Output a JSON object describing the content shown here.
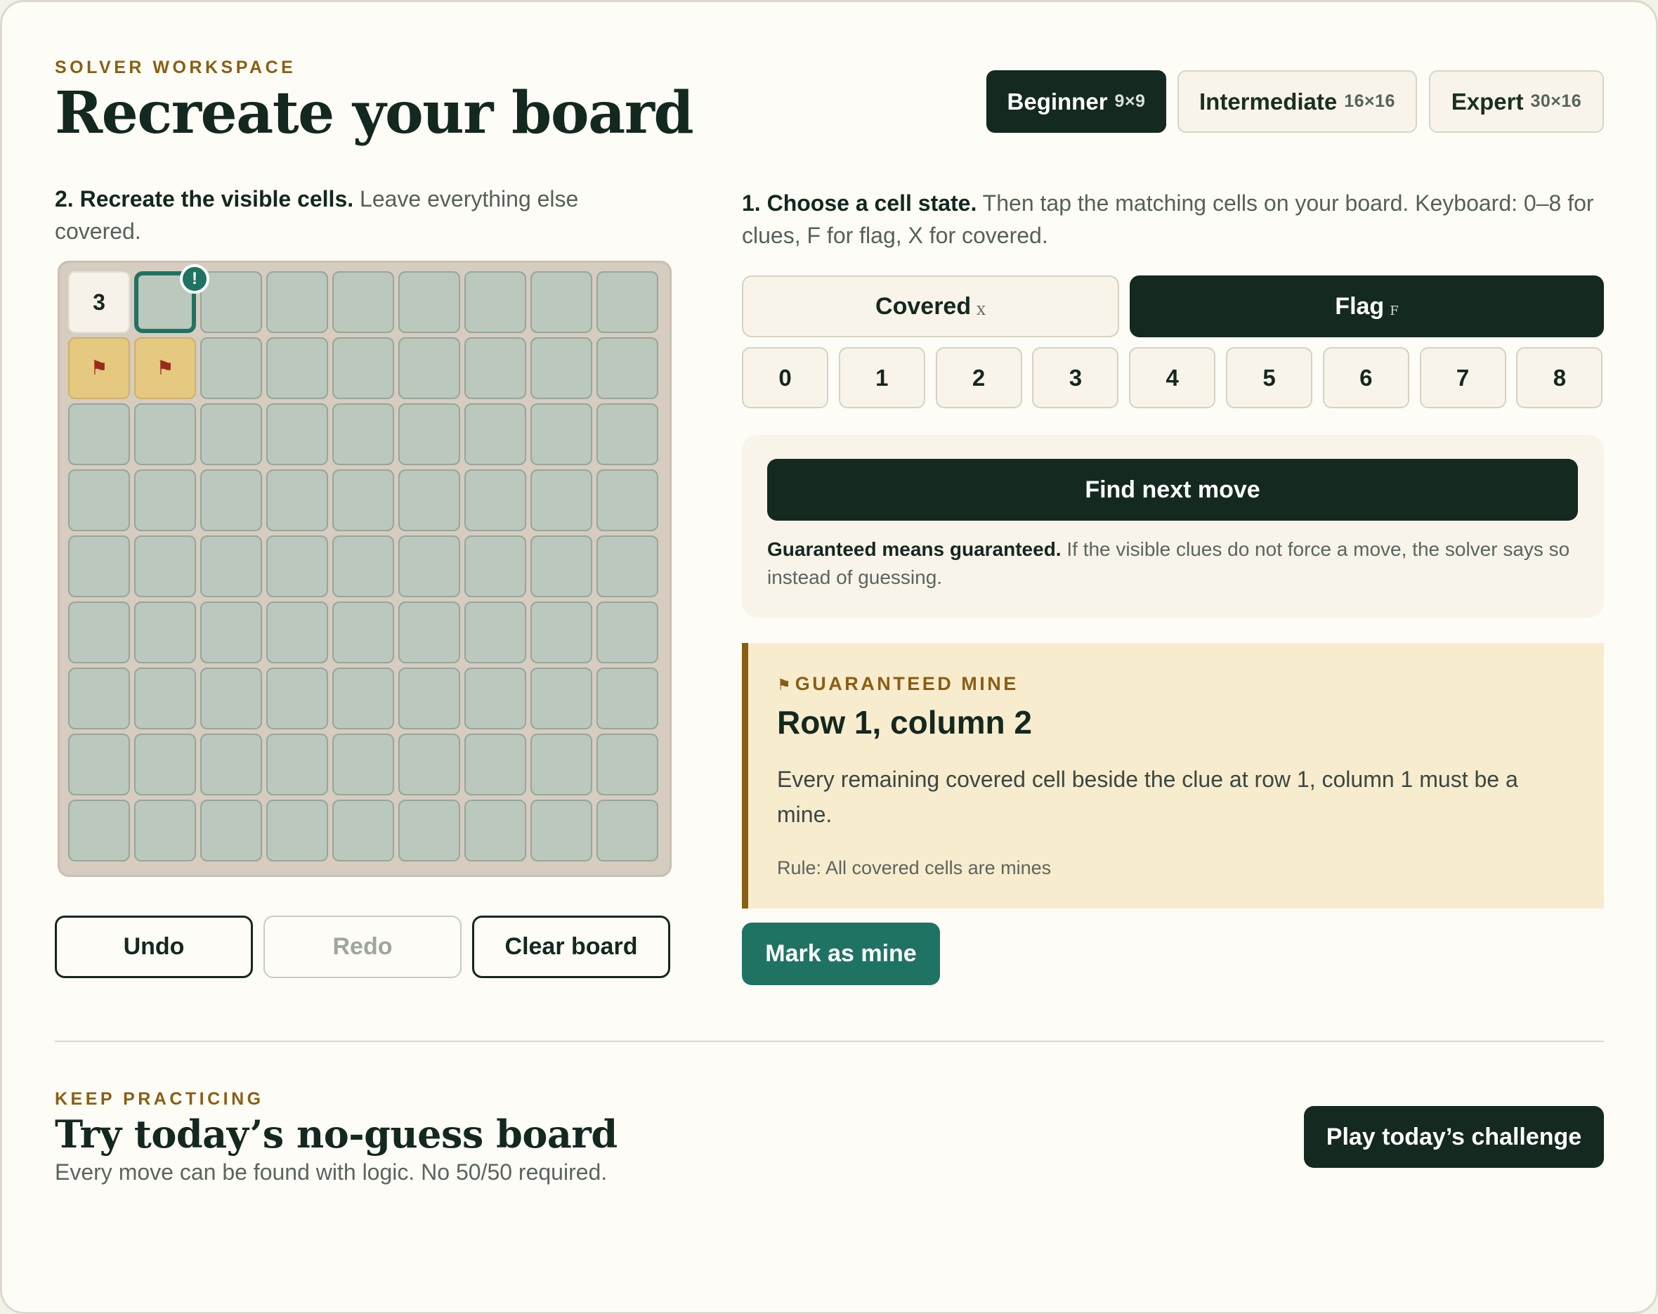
{
  "header": {
    "eyebrow": "SOLVER WORKSPACE",
    "title": "Recreate your board"
  },
  "difficulty": [
    {
      "label": "Beginner",
      "size": "9×9",
      "active": true
    },
    {
      "label": "Intermediate",
      "size": "16×16",
      "active": false
    },
    {
      "label": "Expert",
      "size": "30×16",
      "active": false
    }
  ],
  "left_instruction": {
    "bold": "2. Recreate the visible cells.",
    "text": " Leave everything else covered."
  },
  "right_instruction": {
    "bold": "1. Choose a cell state.",
    "text": " Then tap the matching cells on your board. Keyboard: 0–8 for clues, F for flag, X for covered."
  },
  "board": {
    "rows": 9,
    "cols": 9,
    "cells": [
      [
        "3",
        "target",
        "covered",
        "covered",
        "covered",
        "covered",
        "covered",
        "covered",
        "covered"
      ],
      [
        "flag",
        "flag",
        "covered",
        "covered",
        "covered",
        "covered",
        "covered",
        "covered",
        "covered"
      ],
      [
        "covered",
        "covered",
        "covered",
        "covered",
        "covered",
        "covered",
        "covered",
        "covered",
        "covered"
      ],
      [
        "covered",
        "covered",
        "covered",
        "covered",
        "covered",
        "covered",
        "covered",
        "covered",
        "covered"
      ],
      [
        "covered",
        "covered",
        "covered",
        "covered",
        "covered",
        "covered",
        "covered",
        "covered",
        "covered"
      ],
      [
        "covered",
        "covered",
        "covered",
        "covered",
        "covered",
        "covered",
        "covered",
        "covered",
        "covered"
      ],
      [
        "covered",
        "covered",
        "covered",
        "covered",
        "covered",
        "covered",
        "covered",
        "covered",
        "covered"
      ],
      [
        "covered",
        "covered",
        "covered",
        "covered",
        "covered",
        "covered",
        "covered",
        "covered",
        "covered"
      ],
      [
        "covered",
        "covered",
        "covered",
        "covered",
        "covered",
        "covered",
        "covered",
        "covered",
        "covered"
      ]
    ],
    "badge": "!",
    "flag_glyph": "⚑"
  },
  "actions": {
    "undo": "Undo",
    "redo": "Redo",
    "clear": "Clear board"
  },
  "states": {
    "covered_label": "Covered",
    "covered_key": "X",
    "flag_label": "Flag",
    "flag_key": "F",
    "active": "flag",
    "numbers": [
      "0",
      "1",
      "2",
      "3",
      "4",
      "5",
      "6",
      "7",
      "8"
    ]
  },
  "solver": {
    "find_button": "Find next move",
    "note_bold": "Guaranteed means guaranteed.",
    "note_text": " If the visible clues do not force a move, the solver says so instead of guessing."
  },
  "result": {
    "eyebrow": "GUARANTEED MINE",
    "title": "Row 1, column 2",
    "body": "Every remaining covered cell beside the clue at row 1, column 1 must be a mine.",
    "rule": "Rule: All covered cells are mines",
    "action": "Mark as mine"
  },
  "practice": {
    "eyebrow": "KEEP PRACTICING",
    "title": "Try today’s no-guess board",
    "subtitle": "Every move can be found with logic. No 50/50 required.",
    "button": "Play today’s challenge"
  },
  "colors": {
    "dark": "#14291f",
    "accent": "#1f7362",
    "gold": "#8a5e12",
    "covered": "#bac8bd",
    "flagged": "#e5c980"
  }
}
